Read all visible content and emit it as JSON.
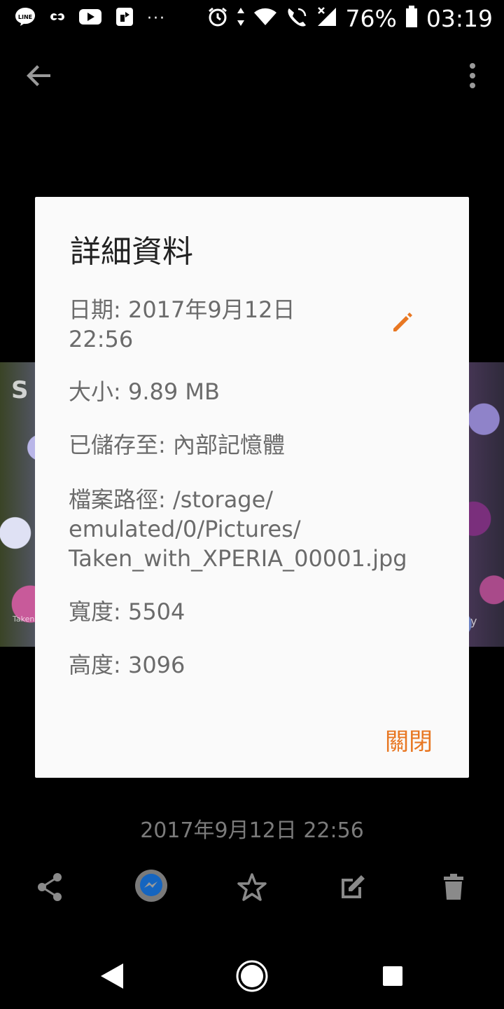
{
  "status_bar": {
    "battery": "76%",
    "time": "03:19",
    "dots": "···"
  },
  "photo": {
    "left_watermark": "S",
    "left_small": "Taken",
    "right_small": "y"
  },
  "dialog": {
    "title": "詳細資料",
    "date_line1": "日期: 2017年9月12日",
    "date_line2": "22:56",
    "size": "大小: 9.89 MB",
    "saved_to": "已儲存至: 內部記憶體",
    "path_line1": "檔案路徑: /storage/",
    "path_line2": "emulated/0/Pictures/",
    "path_line3": "Taken_with_XPERIA_00001.jpg",
    "width": "寬度: 5504",
    "height": "高度: 3096",
    "close_label": "關閉"
  },
  "caption": "2017年9月12日 22:56",
  "colors": {
    "accent": "#e87722",
    "dialog_bg": "#fafafa",
    "page_bg": "#000000"
  }
}
